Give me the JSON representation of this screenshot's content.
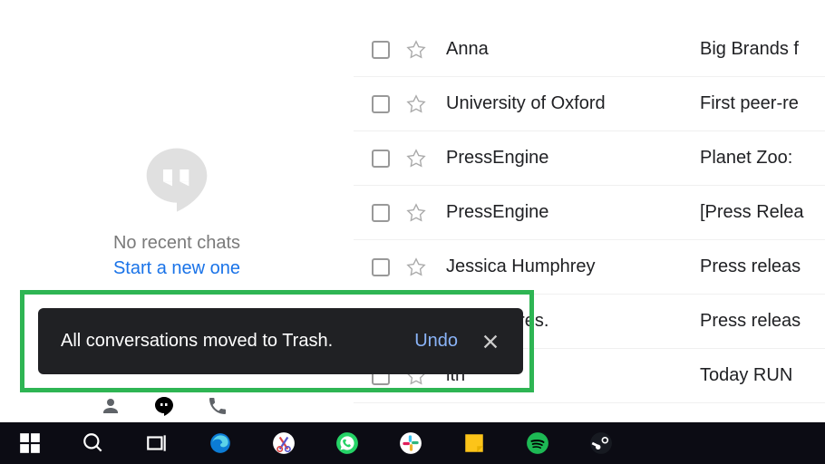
{
  "sidebar": {
    "no_chats": "No recent chats",
    "start_new": "Start a new one"
  },
  "emails": [
    {
      "sender": "Anna",
      "subject": "Big Brands f"
    },
    {
      "sender": "University of Oxford",
      "subject": "First peer-re"
    },
    {
      "sender": "PressEngine",
      "subject": "Planet Zoo:"
    },
    {
      "sender": "PressEngine",
      "subject": "[Press Relea"
    },
    {
      "sender": "Jessica Humphrey",
      "subject": "Press releas"
    },
    {
      "sender": "f Lords Pres.",
      "subject": "Press releas"
    },
    {
      "sender": "ith",
      "subject": "Today RUN"
    }
  ],
  "toast": {
    "message": "All conversations moved to Trash.",
    "undo": "Undo"
  }
}
